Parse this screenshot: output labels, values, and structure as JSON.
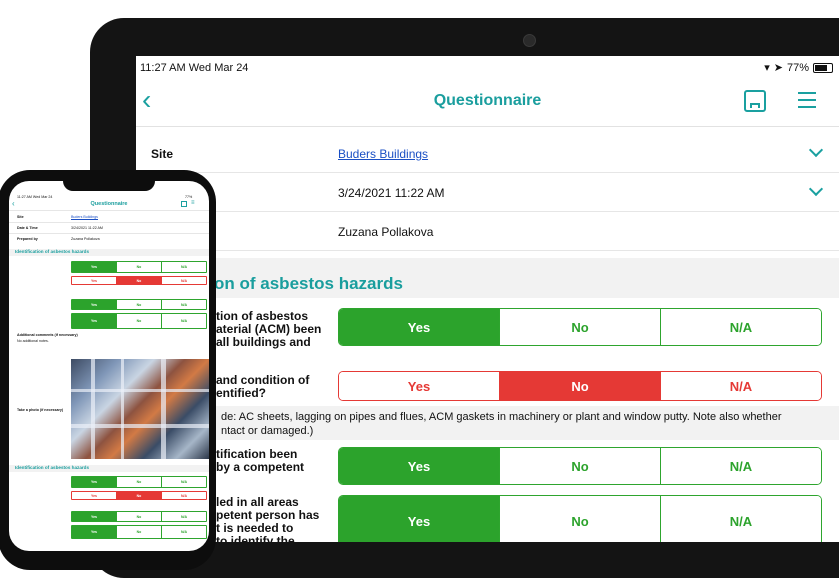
{
  "tablet": {
    "status_time": "11:27 AM  Wed Mar 24",
    "status_battery": "77%",
    "nav_title": "Questionnaire",
    "rows": [
      {
        "label": "Site",
        "value": "Buders Buildings"
      },
      {
        "label": "",
        "value": "3/24/2021 11:22 AM"
      },
      {
        "label": "",
        "value": "Zuzana Pollakova"
      }
    ],
    "section_title": "ication of asbestos hazards",
    "options": [
      "Yes",
      "No",
      "N/A"
    ],
    "questions": [
      "tion of asbestos\naterial (ACM) been\nall buildings and",
      "and condition of\nentified?",
      "tification been\nby a competent",
      "led in all areas\npetent person has\nt is needed to\nto identify the"
    ],
    "note": "de: AC sheets, lagging on pipes and flues, ACM gaskets in machinery or plant and window putty. Note also whether\nntact or damaged.)"
  },
  "phone": {
    "status_time": "11:27 AM  Wed Mar 24",
    "status_battery": "77%",
    "nav_title": "Questionnaire",
    "rows": [
      {
        "label": "Site",
        "value": "Buders Buildings"
      },
      {
        "label": "Date & Time",
        "value": "3/24/2021 11:22 AM"
      },
      {
        "label": "Prepared by",
        "value": "Zuzana Pollakova"
      }
    ],
    "section_title": "Identification of asbestos hazards",
    "options": [
      "Yes",
      "No",
      "N/A"
    ],
    "photo_label": "Take a photo (if necessary)",
    "no_notes": "No additional notes.",
    "additional_comments": "Additional comments (if necessary)"
  },
  "colors": {
    "teal": "#1a9e9e",
    "green": "#2ca32c",
    "red": "#e53935",
    "link": "#1a4fc4"
  }
}
